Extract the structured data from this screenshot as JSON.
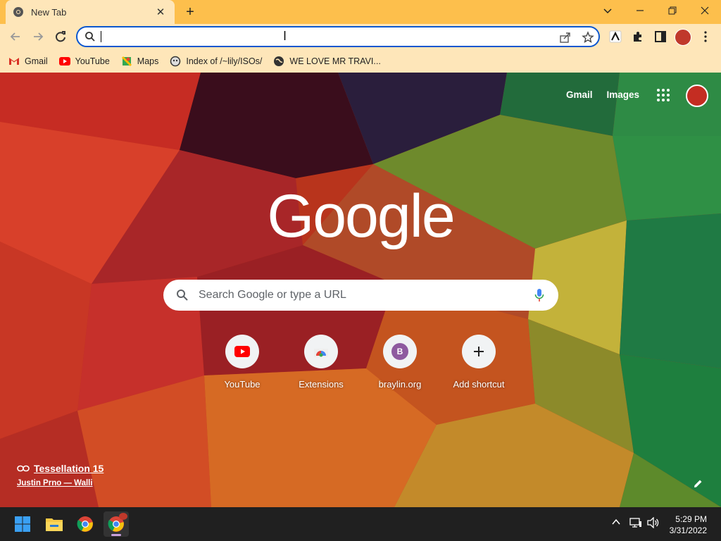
{
  "tab": {
    "title": "New Tab",
    "close": "✕",
    "new_tab": "+"
  },
  "window_controls": {
    "minimize": "—",
    "restore": "❐",
    "close": "✕",
    "tab_search": "⌄"
  },
  "toolbar": {
    "back": "←",
    "forward": "→",
    "reload": "⟳",
    "omnibox_value": "",
    "share_icon": "share-icon",
    "bookmark_icon": "star-icon"
  },
  "bookmarks": [
    {
      "label": "Gmail",
      "icon": "gmail-icon"
    },
    {
      "label": "YouTube",
      "icon": "youtube-icon"
    },
    {
      "label": "Maps",
      "icon": "maps-icon"
    },
    {
      "label": "Index of /~lily/ISOs/",
      "icon": "index-icon"
    },
    {
      "label": "WE LOVE MR TRAVI...",
      "icon": "globe-icon"
    }
  ],
  "ntp": {
    "top_links": {
      "gmail": "Gmail",
      "images": "Images"
    },
    "logo": "Google",
    "search_placeholder": "Search Google or type a URL",
    "shortcuts": [
      {
        "label": "YouTube",
        "icon": "youtube-icon"
      },
      {
        "label": "Extensions",
        "icon": "chrome-web-store-icon"
      },
      {
        "label": "braylin.org",
        "icon": "letter-avatar-icon",
        "letter": "B"
      },
      {
        "label": "Add shortcut",
        "icon": "plus-icon",
        "symbol": "+"
      }
    ],
    "attribution": {
      "title": "Tessellation 15",
      "author": "Justin Prno — Walli"
    }
  },
  "taskbar": {
    "time": "5:29 PM",
    "date": "3/31/2022"
  },
  "colors": {
    "frame": "#fdbf4c",
    "toolbar": "#fee6b9",
    "focus": "#0b57d0"
  }
}
